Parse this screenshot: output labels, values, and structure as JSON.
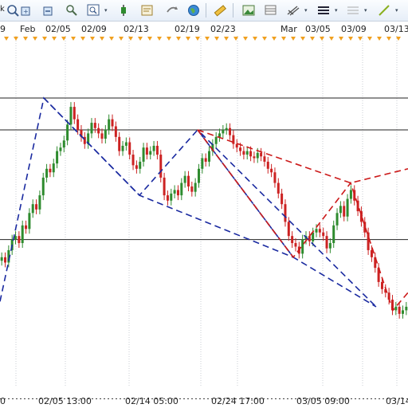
{
  "toolbar": {
    "left_text": "k",
    "buttons": [
      {
        "name": "crosshair-zoom-icon"
      },
      {
        "name": "zoom-in-icon"
      },
      {
        "name": "zoom-out-icon"
      },
      {
        "name": "chart-zoom-icon"
      },
      {
        "name": "data-cursor-icon"
      },
      {
        "name": "chart-properties-icon"
      },
      {
        "name": "refresh-icon"
      },
      {
        "name": "globe-icon"
      },
      {
        "name": "ruler-icon"
      },
      {
        "name": "image-icon"
      },
      {
        "name": "layers-icon"
      },
      {
        "name": "trend-tools-icon"
      },
      {
        "name": "lines-menu-icon"
      },
      {
        "name": "grid-icon"
      },
      {
        "name": "draw-line-icon"
      }
    ],
    "dropdown_glyph": "▾"
  },
  "top_axis": {
    "labels": [
      "9",
      "Feb",
      "02/05",
      "02/09",
      "02/13",
      "02/19",
      "02/23",
      "Mar",
      "03/05",
      "03/09",
      "03/13"
    ]
  },
  "bottom_axis": {
    "labels": [
      "0",
      "02/05 13:00",
      "02/14 05:00",
      "02/24 17:00",
      "03/05 09:00",
      "03/14"
    ]
  },
  "colors": {
    "bullish_candle": "#2e8b2e",
    "bearish_candle": "#cc2222",
    "pattern_blue": "#1a2aa0",
    "pattern_red": "#cc1a1a",
    "level_line": "#222222",
    "grid": "#c8cdd3",
    "event_marker": "#f0a020"
  },
  "chart_data": {
    "type": "candlestick",
    "series": [
      {
        "name": "candles",
        "values": [
          0.1,
          0.07,
          0.14,
          0.2,
          0.22,
          0.18,
          0.28,
          0.26,
          0.35,
          0.4,
          0.37,
          0.45,
          0.55,
          0.6,
          0.58,
          0.63,
          0.7,
          0.72,
          0.76,
          0.85,
          0.95,
          0.88,
          0.82,
          0.78,
          0.74,
          0.8,
          0.86,
          0.83,
          0.8,
          0.77,
          0.82,
          0.88,
          0.84,
          0.78,
          0.7,
          0.73,
          0.75,
          0.68,
          0.62,
          0.6,
          0.64,
          0.72,
          0.68,
          0.7,
          0.73,
          0.68,
          0.55,
          0.45,
          0.42,
          0.46,
          0.48,
          0.45,
          0.52,
          0.56,
          0.5,
          0.47,
          0.52,
          0.6,
          0.66,
          0.64,
          0.7,
          0.74,
          0.78,
          0.8,
          0.82,
          0.83,
          0.79,
          0.74,
          0.72,
          0.7,
          0.68,
          0.7,
          0.67,
          0.66,
          0.69,
          0.67,
          0.64,
          0.6,
          0.58,
          0.52,
          0.46,
          0.4,
          0.3,
          0.22,
          0.18,
          0.16,
          0.12,
          0.2,
          0.22,
          0.19,
          0.24,
          0.26,
          0.24,
          0.22,
          0.15,
          0.18,
          0.28,
          0.35,
          0.39,
          0.33,
          0.43,
          0.48,
          0.42,
          0.36,
          0.3,
          0.24,
          0.14,
          0.1,
          0.04,
          -0.04,
          -0.08,
          -0.1,
          -0.14,
          -0.2,
          -0.18,
          -0.22,
          -0.2,
          -0.18
        ]
      }
    ],
    "horizontal_levels": [
      1.0,
      0.82,
      0.2
    ],
    "dotted_level": -0.7,
    "pattern_blue": [
      [
        0,
        -0.15
      ],
      [
        55,
        1.0
      ],
      [
        175,
        0.45
      ],
      [
        248,
        0.82
      ],
      [
        368,
        0.1
      ],
      [
        472,
        -0.18
      ]
    ],
    "pattern_blue_extra": [
      [
        55,
        1.0
      ],
      [
        175,
        0.45
      ],
      [
        368,
        0.1
      ],
      [
        248,
        0.82
      ],
      [
        472,
        -0.18
      ]
    ],
    "pattern_red": [
      [
        248,
        0.82
      ],
      [
        368,
        0.1
      ],
      [
        440,
        0.52
      ],
      [
        493,
        -0.2
      ],
      [
        512,
        -0.1
      ]
    ],
    "pattern_red_outer": [
      [
        248,
        0.82
      ],
      [
        440,
        0.52
      ],
      [
        512,
        0.6
      ]
    ]
  }
}
